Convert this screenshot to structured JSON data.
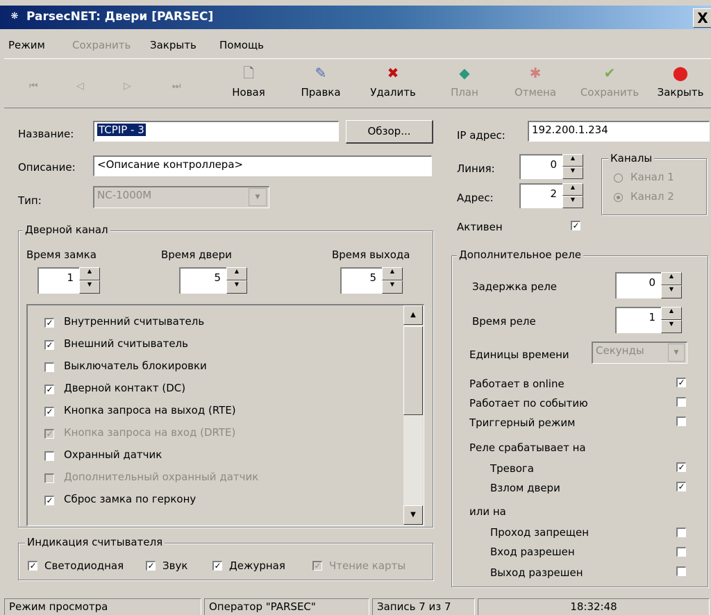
{
  "window": {
    "title": "ParsecNET: Двери [PARSEC]",
    "close_glyph": "X"
  },
  "menu": {
    "mode": "Режим",
    "save": "Сохранить",
    "close": "Закрыть",
    "help": "Помощь"
  },
  "toolbar": {
    "nav": [
      "⏮",
      "◁",
      "▷",
      "⏭"
    ],
    "new": "Новая",
    "edit": "Правка",
    "delete": "Удалить",
    "plan": "План",
    "cancel": "Отмена",
    "save": "Сохранить",
    "close": "Закрыть"
  },
  "form": {
    "name_label": "Название:",
    "name_value": "TCPIP - 3",
    "browse": "Обзор...",
    "desc_label": "Описание:",
    "desc_value": "<Описание контроллера>",
    "type_label": "Тип:",
    "type_value": "NC-1000M",
    "ip_label": "IP адрес:",
    "ip_value": "192.200.1.234",
    "line_label": "Линия:",
    "line_value": "0",
    "addr_label": "Адрес:",
    "addr_value": "2",
    "active_label": "Активен",
    "active": true,
    "channels": {
      "title": "Каналы",
      "ch1": "Канал 1",
      "ch2": "Канал 2",
      "selected": 2
    }
  },
  "door_channel": {
    "title": "Дверной канал",
    "lock_time_label": "Время замка",
    "lock_time": "1",
    "door_time_label": "Время двери",
    "door_time": "5",
    "exit_time_label": "Время выхода",
    "exit_time": "5",
    "items": [
      {
        "label": "Внутренний считыватель",
        "checked": true,
        "enabled": true
      },
      {
        "label": "Внешний считыватель",
        "checked": true,
        "enabled": true
      },
      {
        "label": "Выключатель блокировки",
        "checked": false,
        "enabled": true
      },
      {
        "label": "Дверной контакт (DC)",
        "checked": true,
        "enabled": true
      },
      {
        "label": "Кнопка запроса на выход (RTE)",
        "checked": true,
        "enabled": true
      },
      {
        "label": "Кнопка запроса на вход (DRTE)",
        "checked": true,
        "enabled": false
      },
      {
        "label": "Охранный датчик",
        "checked": false,
        "enabled": true
      },
      {
        "label": "Дополнительный охранный датчик",
        "checked": false,
        "enabled": false
      },
      {
        "label": "Сброс замка по геркону",
        "checked": true,
        "enabled": true
      }
    ]
  },
  "reader_indication": {
    "title": "Индикация считывателя",
    "led": "Светодиодная",
    "sound": "Звук",
    "standby": "Дежурная",
    "card_read": "Чтение карты"
  },
  "relay": {
    "title": "Дополнительное реле",
    "delay_label": "Задержка реле",
    "delay": "0",
    "time_label": "Время реле",
    "time": "1",
    "units_label": "Единицы времени",
    "units_value": "Секунды",
    "online_label": "Работает в online",
    "online": true,
    "event_label": "Работает по событию",
    "event": false,
    "trigger_label": "Триггерный режим",
    "trigger": false,
    "fires_on_label": "Реле срабатывает на",
    "alarm_label": "Тревога",
    "alarm": true,
    "break_label": "Взлом двери",
    "break": true,
    "or_label": "или на",
    "denied_label": "Проход запрещен",
    "denied": false,
    "entry_label": "Вход разрешен",
    "entry": false,
    "exit_label": "Выход разрешен",
    "exit": false
  },
  "status": {
    "mode": "Режим просмотра",
    "operator": "Оператор \"PARSEC\"",
    "record": "Запись 7 из 7",
    "time": "18:32:48"
  }
}
